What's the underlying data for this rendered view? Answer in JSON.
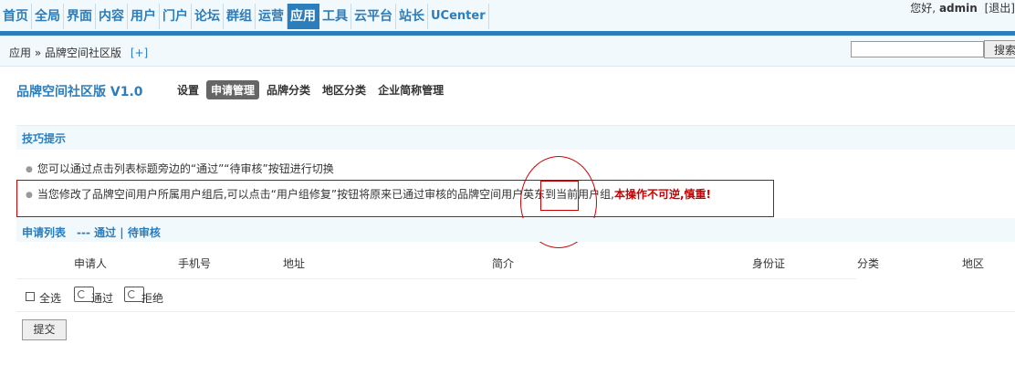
{
  "nav": {
    "items": [
      "首页",
      "全局",
      "界面",
      "内容",
      "用户",
      "门户",
      "论坛",
      "群组",
      "运营",
      "应用",
      "工具",
      "云平台",
      "站长",
      "UCenter"
    ],
    "active": "应用",
    "greeting": "您好,",
    "username": "admin",
    "logout": "[退出]"
  },
  "breadcrumb": {
    "path": "应用 » 品牌空间社区版",
    "add": "[+]"
  },
  "search": {
    "value": "",
    "button": "搜索"
  },
  "plugin": {
    "title": "品牌空间社区版 V1.0",
    "tabs": [
      "设置",
      "申请管理",
      "品牌分类",
      "地区分类",
      "企业简称管理"
    ],
    "active_tab": "申请管理"
  },
  "tips": {
    "title": "技巧提示",
    "tip1": "您可以通过点击列表标题旁边的“通过”“待审核”按钮进行切换",
    "tip2": "当您修改了品牌空间用户所属用户组后,可以点击“用户组修复”按钮将原来已通过审核的品牌空间用户英东到当前用户组,",
    "tip2_warning": "本操作不可逆,慎重!"
  },
  "list": {
    "title": "申请列表",
    "filter_links": "--- 通过 | 待审核",
    "columns": [
      "申请人",
      "手机号",
      "地址",
      "简介",
      "身份证",
      "分类",
      "地区"
    ],
    "select_all": "全选",
    "approve": "通过",
    "reject": "拒绝",
    "submit": "提交"
  },
  "colors": {
    "accent": "#2b7dbc",
    "annotation": "#cc0000",
    "warning": "#cc0000"
  }
}
